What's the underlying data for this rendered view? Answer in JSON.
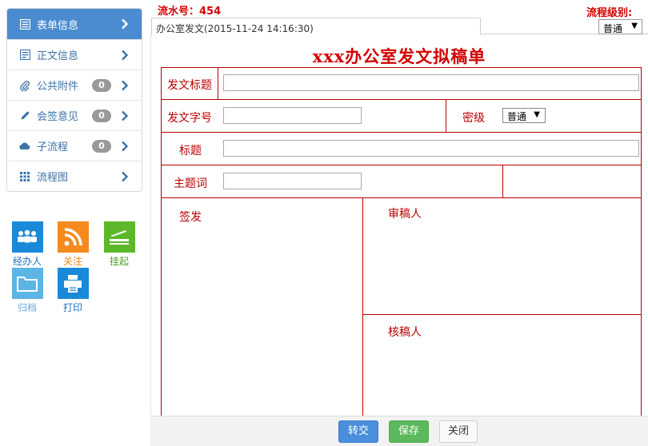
{
  "nav": {
    "items": [
      {
        "label": "表单信息",
        "icon": "list-icon",
        "active": true,
        "badge": ""
      },
      {
        "label": "正文信息",
        "icon": "document-icon",
        "active": false,
        "badge": ""
      },
      {
        "label": "公共附件",
        "icon": "paperclip-icon",
        "active": false,
        "badge": "0"
      },
      {
        "label": "会签意见",
        "icon": "pencil-icon",
        "active": false,
        "badge": "0"
      },
      {
        "label": "子流程",
        "icon": "cloud-icon",
        "active": false,
        "badge": "0"
      },
      {
        "label": "流程图",
        "icon": "grid-icon",
        "active": false,
        "badge": ""
      }
    ]
  },
  "tools": [
    {
      "label": "经办人",
      "icon": "people-icon",
      "color": "#1a8ad8",
      "labelColor": "#1a6fc0"
    },
    {
      "label": "关注",
      "icon": "rss-icon",
      "color": "#f58a1f",
      "labelColor": "#e88a1a"
    },
    {
      "label": "挂起",
      "icon": "scanner-icon",
      "color": "#5cb82a",
      "labelColor": "#4aa020"
    },
    {
      "label": "归档",
      "icon": "folder-icon",
      "color": "#5bb5e5",
      "labelColor": "#6aa8d8"
    },
    {
      "label": "打印",
      "icon": "printer-icon",
      "color": "#1a8ad8",
      "labelColor": "#1a6fc0"
    }
  ],
  "header": {
    "serial": "流水号：454",
    "flow_level_label": "流程级别:",
    "tab_label": "办公室发文(2015-11-24 14:16:30)",
    "level_value": "普通"
  },
  "form": {
    "title": "xxx办公室发文拟稿单",
    "doc_title_label": "发文标题",
    "doc_number_label": "发文字号",
    "secret_label": "密级",
    "secret_value": "普通",
    "title_label": "标题",
    "keywords_label": "主题词",
    "sign_label": "签发",
    "review_label": "审稿人",
    "check_label": "核稿人"
  },
  "footer": {
    "submit_label": "转交",
    "save_label": "保存",
    "close_label": "关闭"
  },
  "colors": {
    "accent": "#4a8ccf",
    "form_red": "#b80000",
    "title_red": "#d40000"
  }
}
